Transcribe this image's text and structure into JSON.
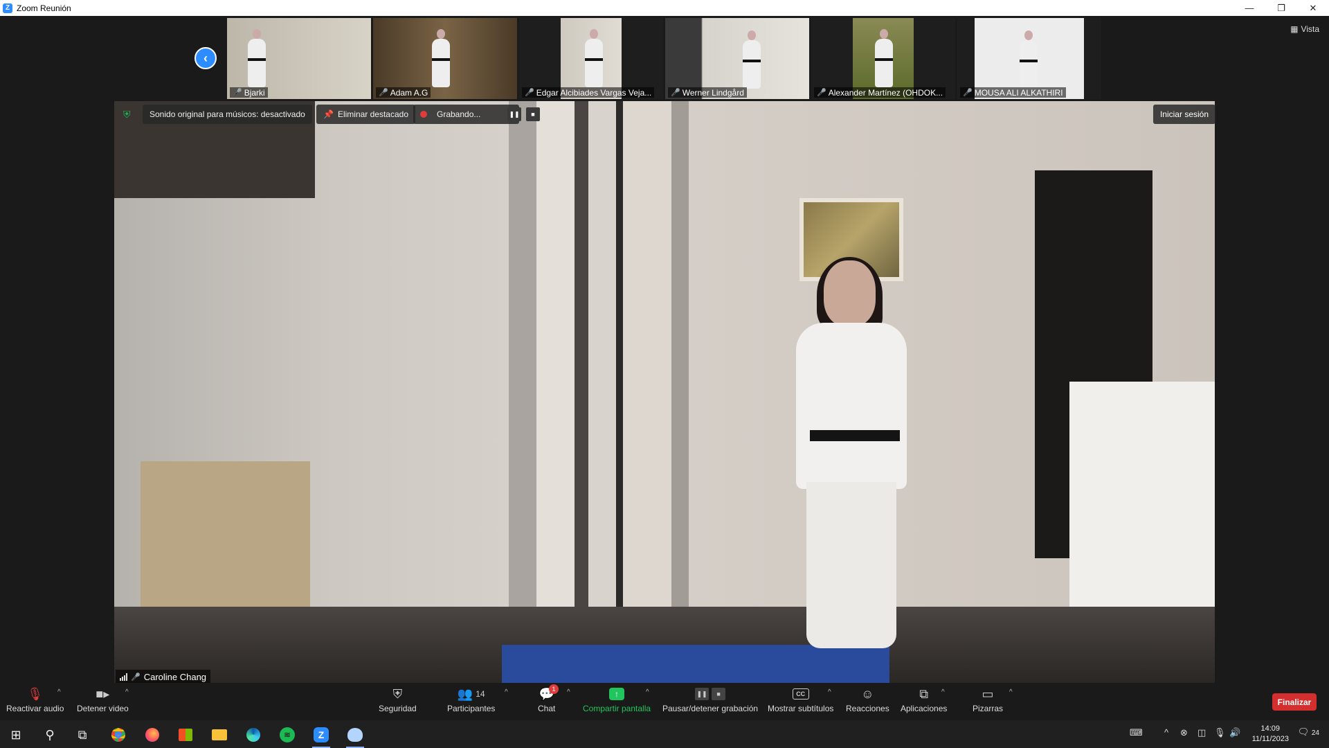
{
  "window": {
    "title": "Zoom Reunión",
    "minimize": "—",
    "restore": "❐",
    "close": "✕"
  },
  "view_button": {
    "label": "Vista"
  },
  "thumbnails": [
    {
      "name": "Bjarki",
      "bg": "#c8c4b8"
    },
    {
      "name": "Adam A.G",
      "bg": "#5b4a34"
    },
    {
      "name": "Edgar Alcibiades Vargas Veja...",
      "bg": "#2a2a2a"
    },
    {
      "name": "Werner Lindgård",
      "bg": "#d6d3cc"
    },
    {
      "name": "Alexander Martínez (OHDOK...",
      "bg": "#6a6d3c"
    },
    {
      "name": "MOUSA ALI ALKATHIRI",
      "bg": "#e9e9e9"
    }
  ],
  "meeting_bar": {
    "original_sound": "Sonido original para músicos: desactivado",
    "remove_spotlight": "Eliminar destacado",
    "recording": "Grabando...",
    "sign_in": "Iniciar sesión"
  },
  "main_speaker": {
    "name": "Caroline Chang"
  },
  "toolbar": {
    "unmute": "Reactivar audio",
    "stop_video": "Detener video",
    "security": "Seguridad",
    "participants": "Participantes",
    "participants_count": "14",
    "chat": "Chat",
    "chat_badge": "1",
    "share_screen": "Compartir pantalla",
    "pause_stop_recording": "Pausar/detener grabación",
    "show_captions": "Mostrar subtítulos",
    "reactions": "Reacciones",
    "apps": "Aplicaciones",
    "whiteboards": "Pizarras",
    "end": "Finalizar"
  },
  "taskbar": {
    "time": "14:09",
    "date": "11/11/2023",
    "notifications": "24"
  },
  "colors": {
    "zoom_blue": "#2d8cff",
    "share_green": "#21c55d",
    "end_red": "#d32f2f",
    "muted_red": "#e03c3c"
  }
}
